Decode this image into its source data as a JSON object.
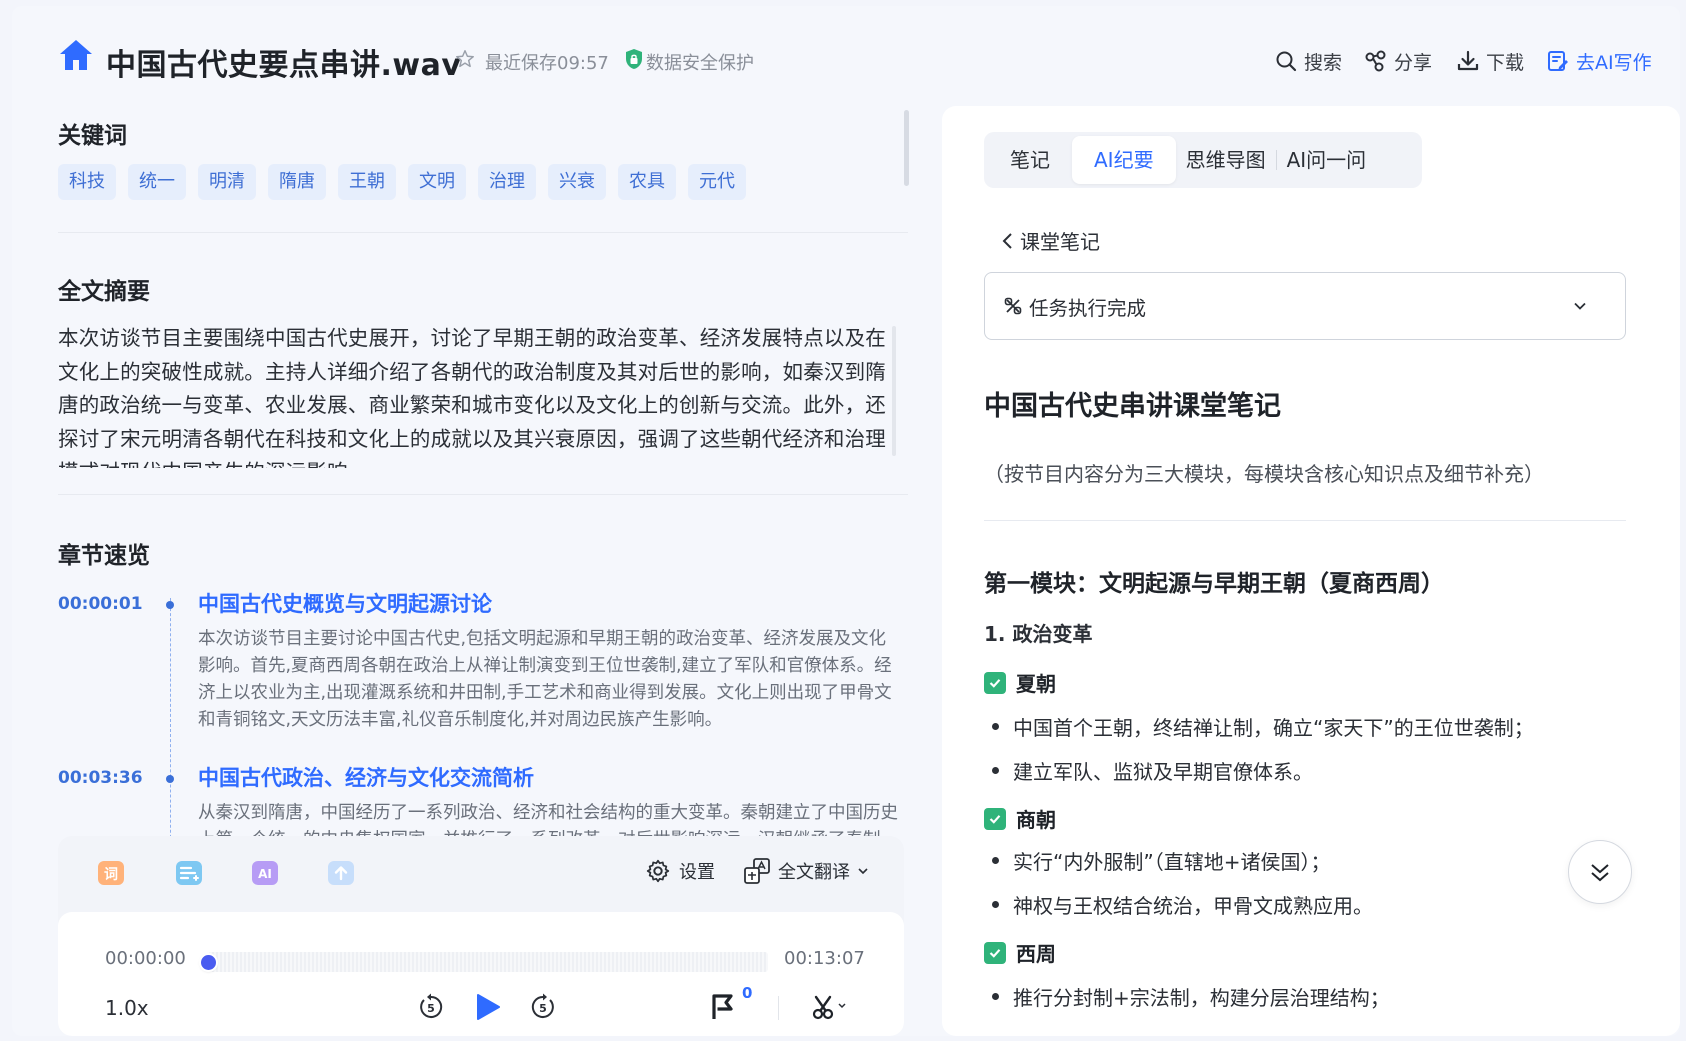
{
  "header": {
    "file_title": "中国古代史要点串讲.wav",
    "save_status": "最近保存09:57",
    "security_label": "数据安全保护",
    "actions": {
      "search": "搜索",
      "share": "分享",
      "download": "下载",
      "ai_write": "去AI写作"
    }
  },
  "keywords": {
    "title": "关键词",
    "items": [
      "科技",
      "统一",
      "明清",
      "隋唐",
      "王朝",
      "文明",
      "治理",
      "兴衰",
      "农具",
      "元代"
    ]
  },
  "summary": {
    "title": "全文摘要",
    "text": "本次访谈节目主要围绕中国古代史展开，讨论了早期王朝的政治变革、经济发展特点以及在文化上的突破性成就。主持人详细介绍了各朝代的政治制度及其对后世的影响，如秦汉到隋唐的政治统一与变革、农业发展、商业繁荣和城市变化以及文化上的创新与交流。此外，还探讨了宋元明清各朝代在科技和文化上的成就以及其兴衰原因，强调了这些朝代经济和治理模式对现代中国产生的深远影响。"
  },
  "chapters": {
    "title": "章节速览",
    "items": [
      {
        "time": "00:00:01",
        "title": "中国古代史概览与文明起源讨论",
        "desc": "本次访谈节目主要讨论中国古代史,包括文明起源和早期王朝的政治变革、经济发展及文化影响。首先,夏商西周各朝在政治上从禅让制演变到王位世袭制,建立了军队和官僚体系。经济上以农业为主,出现灌溉系统和井田制,手工艺术和商业得到发展。文化上则出现了甲骨文和青铜铭文,天文历法丰富,礼仪音乐制度化,并对周边民族产生影响。"
      },
      {
        "time": "00:03:36",
        "title": "中国古代政治、经济与文化交流简析",
        "desc": "从秦汉到隋唐，中国经历了一系列政治、经济和社会结构的重大变革。秦朝建立了中国历史上第一个统一的中央集权国家，并推行了一系列改革，对后世影响深远。汉朝继承了秦制。"
      }
    ]
  },
  "player": {
    "settings_label": "设置",
    "translate_label": "全文翻译",
    "time_current": "00:00:00",
    "time_total": "00:13:07",
    "progress": 0,
    "speed": "1.0x",
    "skip_seconds": "5",
    "flag_count": "0",
    "tools": [
      "word-icon",
      "list-icon",
      "ai-icon",
      "upload-icon"
    ]
  },
  "right_panel": {
    "tabs": [
      "笔记",
      "AI纪要",
      "思维导图",
      "AI问一问"
    ],
    "active_tab": 1,
    "back_label": "课堂笔记",
    "status": "任务执行完成",
    "note_title": "中国古代史串讲课堂笔记",
    "note_subtitle": "（按节目内容分为三大模块，每模块含核心知识点及细节补充）",
    "module_title": "第一模块：文明起源与早期王朝（夏商西周）",
    "sub_heading": "1. 政治变革",
    "sections": [
      {
        "name": "夏朝",
        "bullets": [
          "中国首个王朝，终结禅让制，确立“家天下”的王位世袭制；",
          "建立军队、监狱及早期官僚体系。"
        ]
      },
      {
        "name": "商朝",
        "bullets": [
          "实行“内外服制”（直辖地+诸侯国）；",
          "神权与王权结合统治，甲骨文成熟应用。"
        ]
      },
      {
        "name": "西周",
        "bullets": [
          "推行分封制+宗法制，构建分层治理结构；"
        ]
      }
    ]
  },
  "colors": {
    "accent": "#2f6bff",
    "keyword_bg": "#e6eefc",
    "check_green": "#2fb37a",
    "security_green": "#2fb37a"
  }
}
